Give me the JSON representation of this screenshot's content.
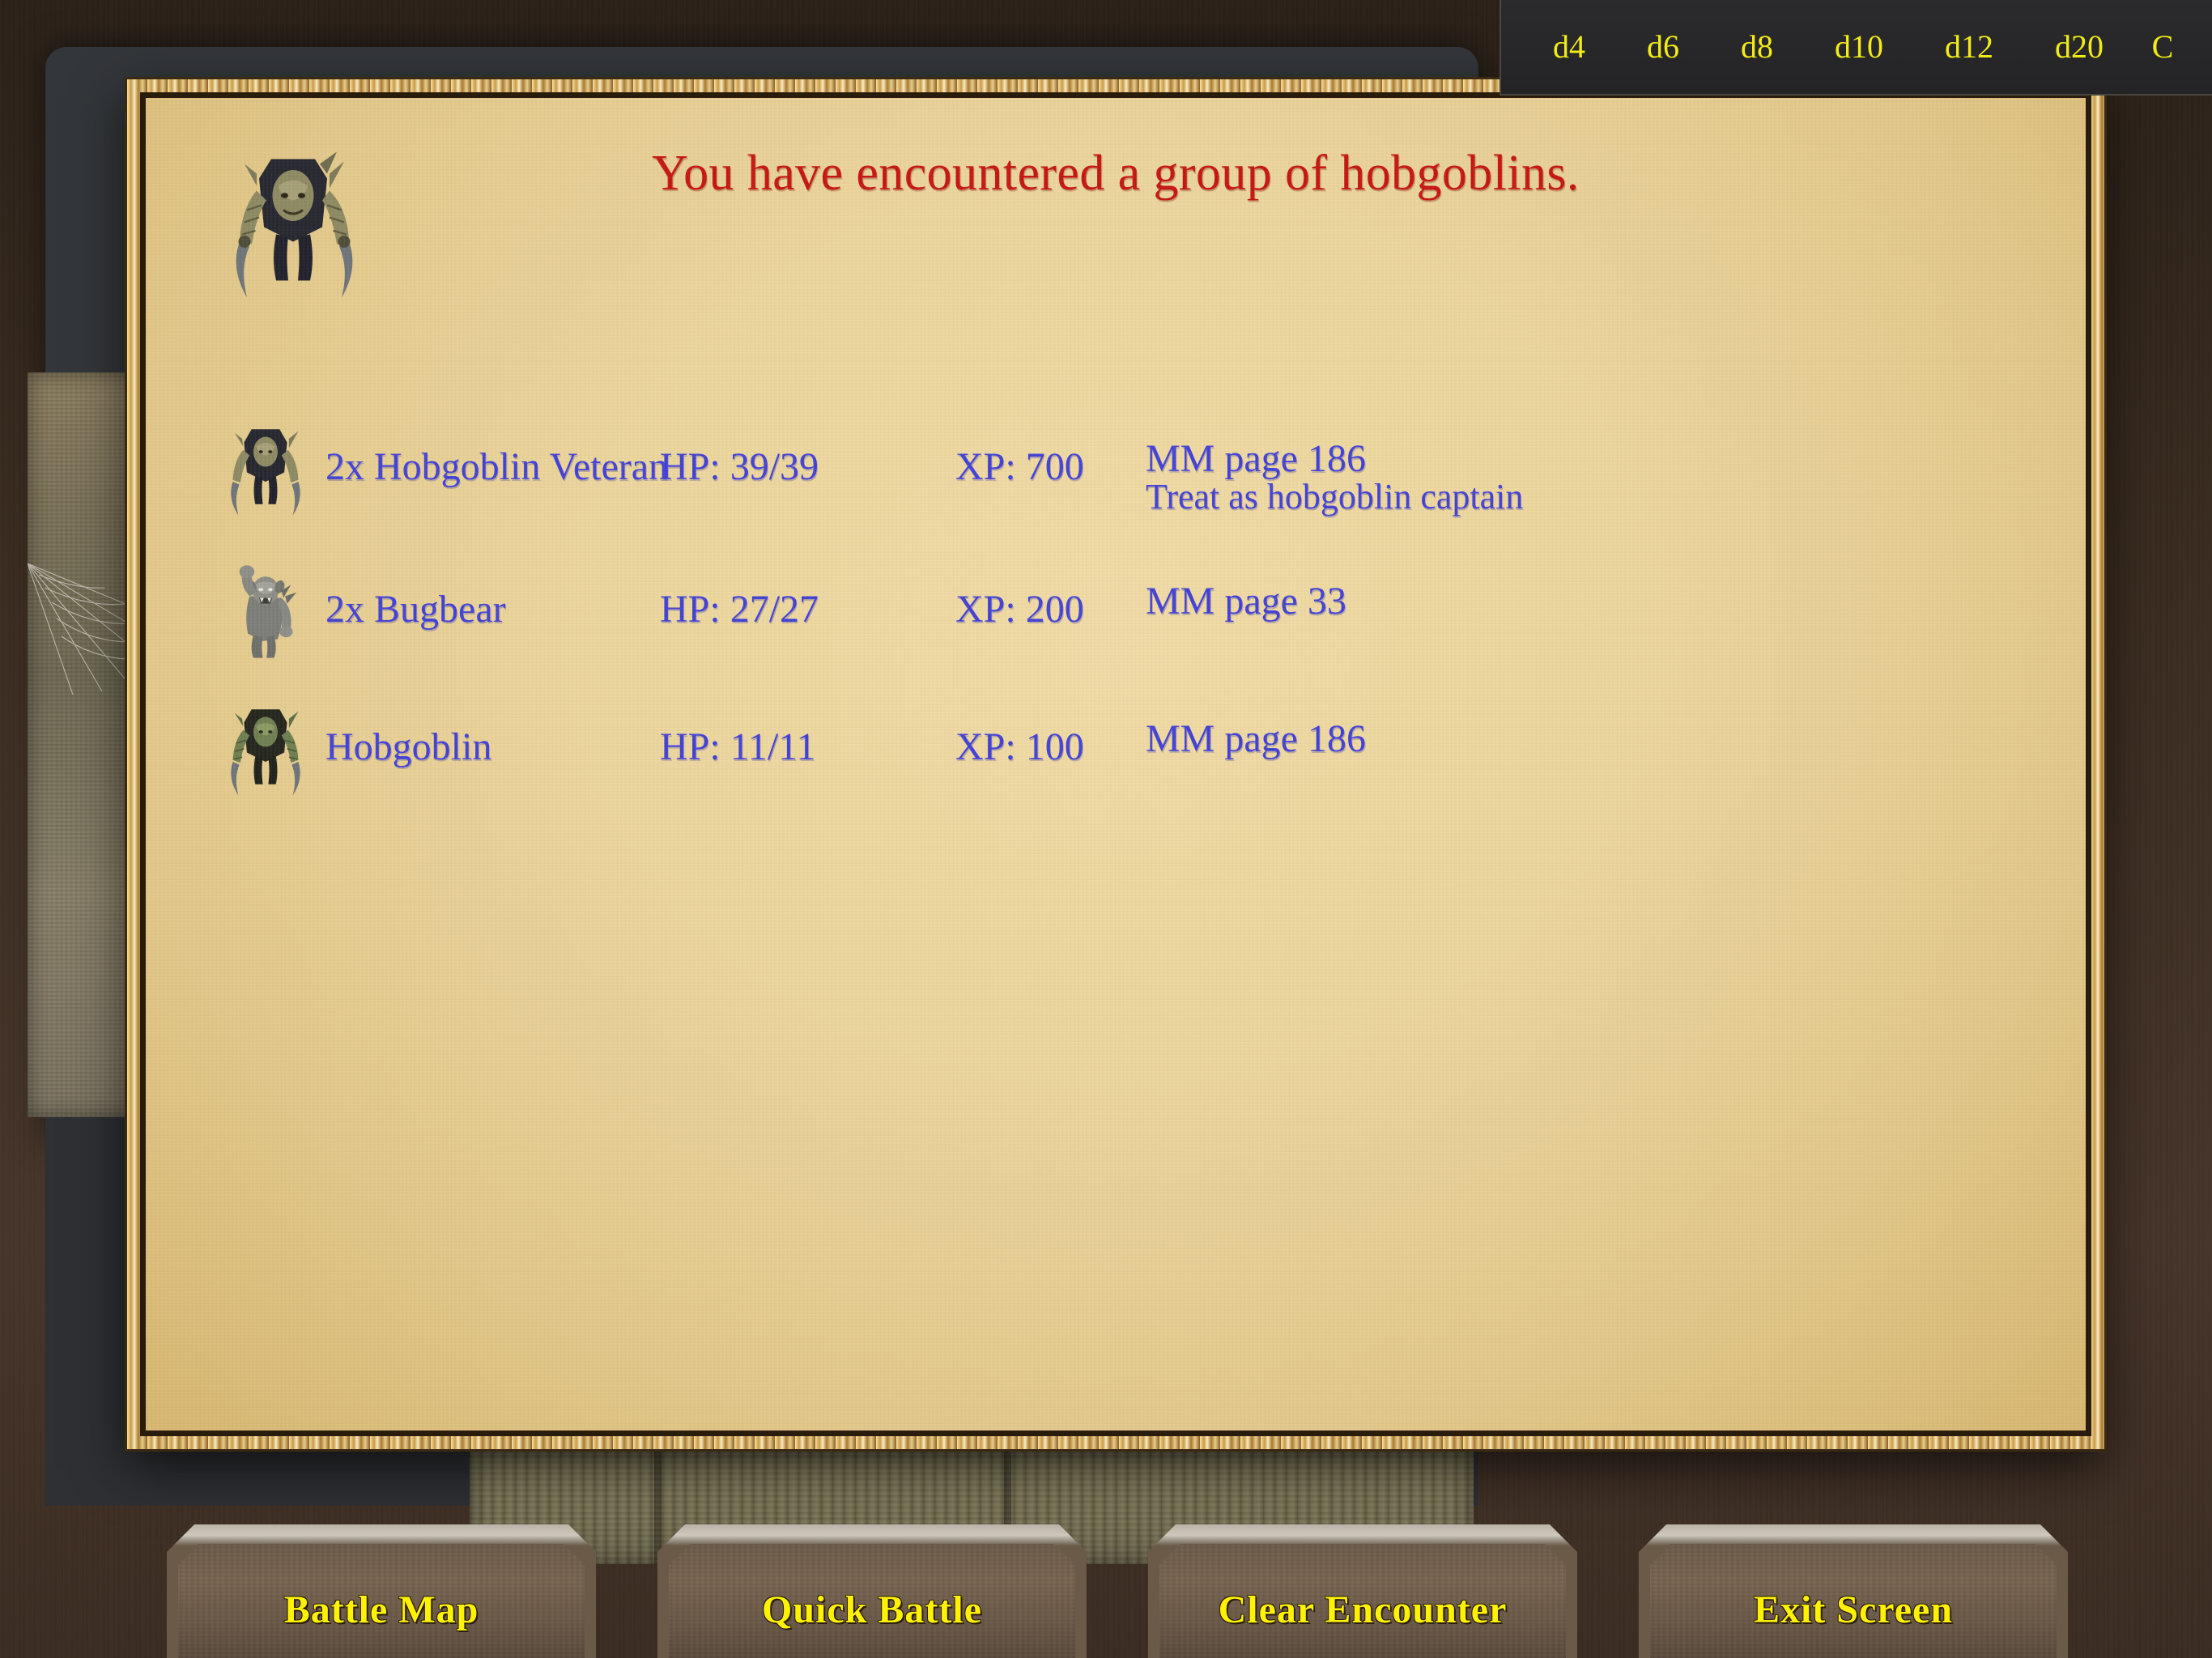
{
  "dice_bar": {
    "items": [
      {
        "label": "d4",
        "name": "dice-d4"
      },
      {
        "label": "d6",
        "name": "dice-d6"
      },
      {
        "label": "d8",
        "name": "dice-d8"
      },
      {
        "label": "d10",
        "name": "dice-d10"
      },
      {
        "label": "d12",
        "name": "dice-d12"
      },
      {
        "label": "d20",
        "name": "dice-d20"
      },
      {
        "label": "C",
        "name": "dice-clear"
      }
    ]
  },
  "dialog": {
    "title": "You have encountered a group of hobgoblins.",
    "title_color": "#c81410",
    "text_color": "#4140d8",
    "hero_icon": "hobgoblin-sprite"
  },
  "monsters": [
    {
      "name": "2x Hobgoblin Veteran",
      "hp": "HP: 39/39",
      "xp": "XP: 700",
      "reference": "MM page 186",
      "note": "Treat as hobgoblin captain",
      "icon": "hobgoblin-veteran-icon"
    },
    {
      "name": "2x Bugbear",
      "hp": "HP: 27/27",
      "xp": "XP: 200",
      "reference": "MM page 33",
      "note": "",
      "icon": "bugbear-icon"
    },
    {
      "name": "Hobgoblin",
      "hp": "HP: 11/11",
      "xp": "XP: 100",
      "reference": "MM page 186",
      "note": "",
      "icon": "hobgoblin-icon"
    }
  ],
  "buttons": [
    {
      "label": "Battle Map",
      "name": "battle-map-button"
    },
    {
      "label": "Quick Battle",
      "name": "quick-battle-button"
    },
    {
      "label": "Clear Encounter",
      "name": "clear-encounter-button"
    },
    {
      "label": "Exit Screen",
      "name": "exit-screen-button"
    }
  ],
  "colors": {
    "accent_yellow": "#fff200",
    "title_red": "#c81410",
    "body_blue": "#4140d8",
    "parchment": "#eed79d",
    "frame_gold": "#d8ab55"
  }
}
